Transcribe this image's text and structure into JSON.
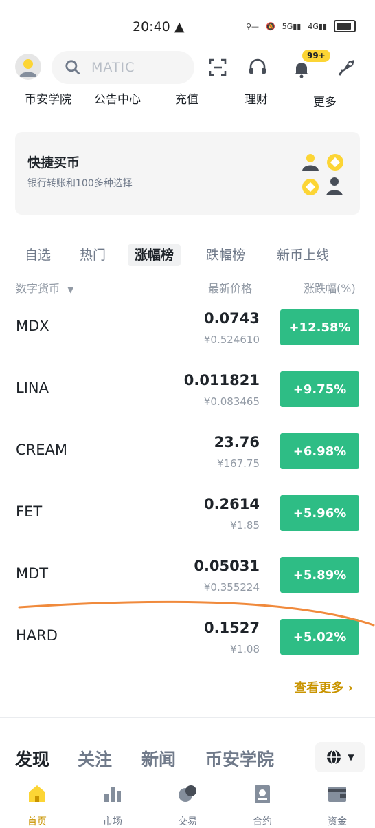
{
  "status_bar": {
    "time": "20:40",
    "net1": "5G",
    "net2": "4G"
  },
  "header": {
    "search_placeholder": "MATIC",
    "badge": "99+"
  },
  "quick_links": [
    {
      "label": "币安学院"
    },
    {
      "label": "公告中心"
    },
    {
      "label": "充值"
    },
    {
      "label": "理财"
    },
    {
      "label": "更多"
    }
  ],
  "card": {
    "title": "快捷买币",
    "subtitle": "银行转账和100多种选择"
  },
  "tabs": [
    {
      "label": "自选"
    },
    {
      "label": "热门"
    },
    {
      "label": "涨幅榜"
    },
    {
      "label": "跌幅榜"
    },
    {
      "label": "新币上线"
    }
  ],
  "columns": {
    "coin": "数字货币",
    "price": "最新价格",
    "change": "涨跌幅(%)"
  },
  "rows": [
    {
      "symbol": "MDX",
      "price": "0.0743",
      "cny": "¥0.524610",
      "change": "+12.58%"
    },
    {
      "symbol": "LINA",
      "price": "0.011821",
      "cny": "¥0.083465",
      "change": "+9.75%"
    },
    {
      "symbol": "CREAM",
      "price": "23.76",
      "cny": "¥167.75",
      "change": "+6.98%"
    },
    {
      "symbol": "FET",
      "price": "0.2614",
      "cny": "¥1.85",
      "change": "+5.96%"
    },
    {
      "symbol": "MDT",
      "price": "0.05031",
      "cny": "¥0.355224",
      "change": "+5.89%"
    },
    {
      "symbol": "HARD",
      "price": "0.1527",
      "cny": "¥1.08",
      "change": "+5.02%"
    }
  ],
  "see_more": "查看更多",
  "discover_tabs": [
    {
      "label": "发现"
    },
    {
      "label": "关注"
    },
    {
      "label": "新闻"
    },
    {
      "label": "币安学院"
    }
  ],
  "nav": [
    {
      "label": "首页"
    },
    {
      "label": "市场"
    },
    {
      "label": "交易"
    },
    {
      "label": "合约"
    },
    {
      "label": "资金"
    }
  ],
  "colors": {
    "accent": "#fcd535",
    "up": "#2ebd85",
    "link": "#c99400",
    "annotation": "#f08a3c"
  }
}
